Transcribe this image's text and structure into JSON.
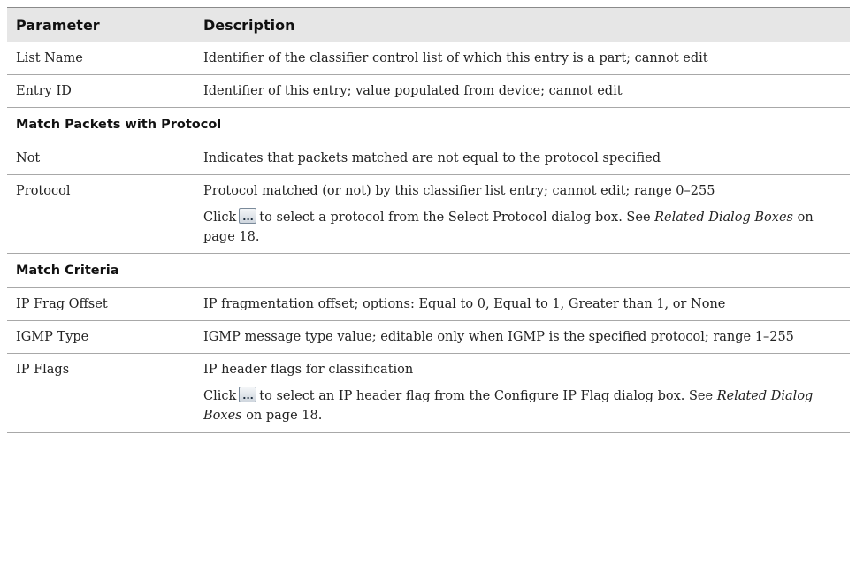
{
  "header": {
    "col1": "Parameter",
    "col2": "Description"
  },
  "rows": [
    {
      "param": "List Name",
      "desc": "Identifier of the classifier control list of which this entry is a part; cannot edit"
    },
    {
      "param": "Entry ID",
      "desc": "Identifier of this entry; value populated from device; cannot edit"
    },
    {
      "section": "Match Packets with Protocol"
    },
    {
      "param": "Not",
      "desc": "Indicates that packets matched are not equal to the protocol specified"
    },
    {
      "param": "Protocol",
      "desc": "Protocol matched (or not) by this classifier list entry; cannot edit; range 0–255",
      "extra": {
        "pre": "Click",
        "post": "to select a protocol from the Select Protocol dialog box. See ",
        "ref": "Related Dialog Boxes",
        "page": " on page 18",
        "end": "."
      }
    },
    {
      "section": "Match Criteria"
    },
    {
      "param": "IP Frag Offset",
      "desc": "IP fragmentation offset; options: Equal to 0, Equal to 1, Greater than 1, or None"
    },
    {
      "param": "IGMP Type",
      "desc": "IGMP message type value; editable only when IGMP is the specified protocol; range 1–255"
    },
    {
      "param": "IP Flags",
      "desc": "IP header flags for classification",
      "extra": {
        "pre": "Click",
        "post": "to select an IP header flag from the Configure IP Flag dialog box. See ",
        "ref": "Related Dialog Boxes",
        "page": " on page 18",
        "end": "."
      }
    }
  ],
  "icons": {
    "browse": "ellipsis-button-icon"
  }
}
